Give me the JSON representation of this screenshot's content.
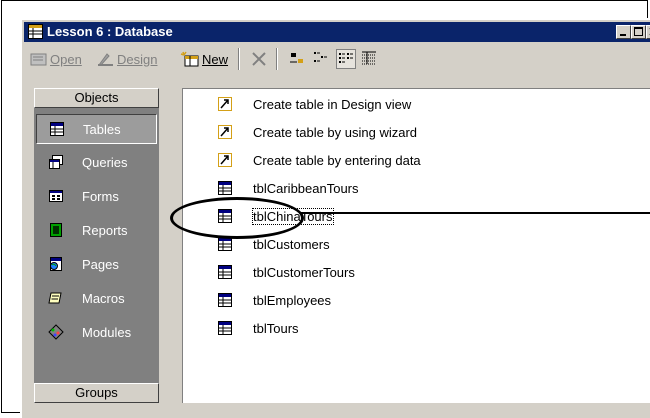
{
  "window": {
    "title": "Lesson 6 : Database",
    "caption_buttons": [
      "minimize",
      "maximize",
      "close"
    ]
  },
  "toolbar": {
    "open_label": "Open",
    "design_label": "Design",
    "new_label": "New",
    "open_enabled": false,
    "design_enabled": false,
    "new_enabled": true
  },
  "sidebar": {
    "objects_header": "Objects",
    "groups_header": "Groups",
    "items": [
      {
        "label": "Tables",
        "icon": "table-icon",
        "selected": true
      },
      {
        "label": "Queries",
        "icon": "query-icon",
        "selected": false
      },
      {
        "label": "Forms",
        "icon": "form-icon",
        "selected": false
      },
      {
        "label": "Reports",
        "icon": "report-icon",
        "selected": false
      },
      {
        "label": "Pages",
        "icon": "page-icon",
        "selected": false
      },
      {
        "label": "Macros",
        "icon": "macro-icon",
        "selected": false
      },
      {
        "label": "Modules",
        "icon": "module-icon",
        "selected": false
      }
    ]
  },
  "objects_list": {
    "items": [
      {
        "label": "Create table in Design view",
        "icon": "shortcut-icon"
      },
      {
        "label": "Create table by using wizard",
        "icon": "shortcut-icon"
      },
      {
        "label": "Create table by entering data",
        "icon": "shortcut-icon"
      },
      {
        "label": "tblCaribbeanTours",
        "icon": "table-icon"
      },
      {
        "label": "tblChinaTours",
        "icon": "table-icon",
        "focused": true
      },
      {
        "label": "tblCustomers",
        "icon": "table-icon"
      },
      {
        "label": "tblCustomerTours",
        "icon": "table-icon"
      },
      {
        "label": "tblEmployees",
        "icon": "table-icon"
      },
      {
        "label": "tblTours",
        "icon": "table-icon"
      }
    ]
  },
  "colors": {
    "title_bar": "#0a246a",
    "window_face": "#d4d0c8",
    "sidebar_bg": "#808080"
  }
}
